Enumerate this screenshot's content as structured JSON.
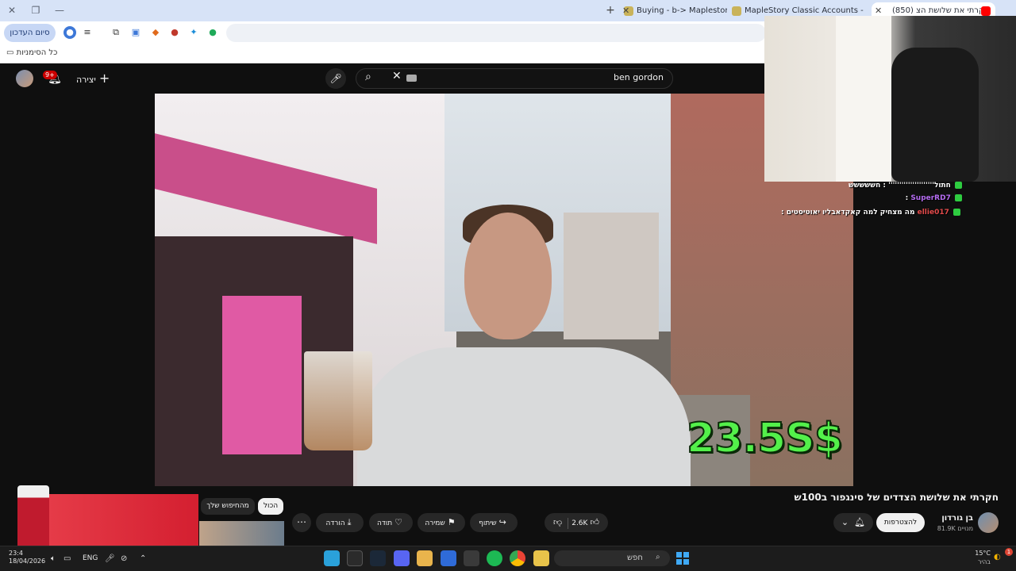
{
  "browser": {
    "tabs": [
      {
        "label": "Buying - b-> Maplestory classic",
        "active": false
      },
      {
        "label": "MapleStory Classic Accounts - ",
        "active": false
      },
      {
        "label": "(850) חקרתי את שלושת הצ",
        "active": true
      }
    ],
    "sidepanel_label": "סיום העדכון",
    "bookmarks_all": "כל הסימניות"
  },
  "yt": {
    "search_value": "ben gordon",
    "create_label": "יצירה",
    "notif_count": "9+"
  },
  "video": {
    "price_overlay": "23.5S$"
  },
  "chat": [
    {
      "user": "",
      "text": "חתול''''''''''''''''''''' : חששששש"
    },
    {
      "user": "SuperRD7",
      "text": ":"
    },
    {
      "user": "ellie017",
      "text": ": מה מצחיק למה קאקדאבליו יאוטיסטים"
    }
  ],
  "below": {
    "title": "חקרתי את שלושת הצדדים של סינגפור ב100ש",
    "channel_name": "בן גורדון",
    "channel_subs": "81.9K מנויים",
    "join_label": "להצטרפות",
    "like_count": "2.6K",
    "share_label": "שיתוף",
    "save_label": "שמירה",
    "thanks_label": "תודה",
    "download_label": "הורדה",
    "chips": [
      "הכול",
      "מהחיפוש שלך"
    ]
  },
  "taskbar": {
    "time": "23:4",
    "date": "18/04/2026",
    "lang": "ENG",
    "search_label": "חפש",
    "weather_temp": "15°C",
    "weather_desc": "בהיר",
    "notif_badge": "1"
  }
}
